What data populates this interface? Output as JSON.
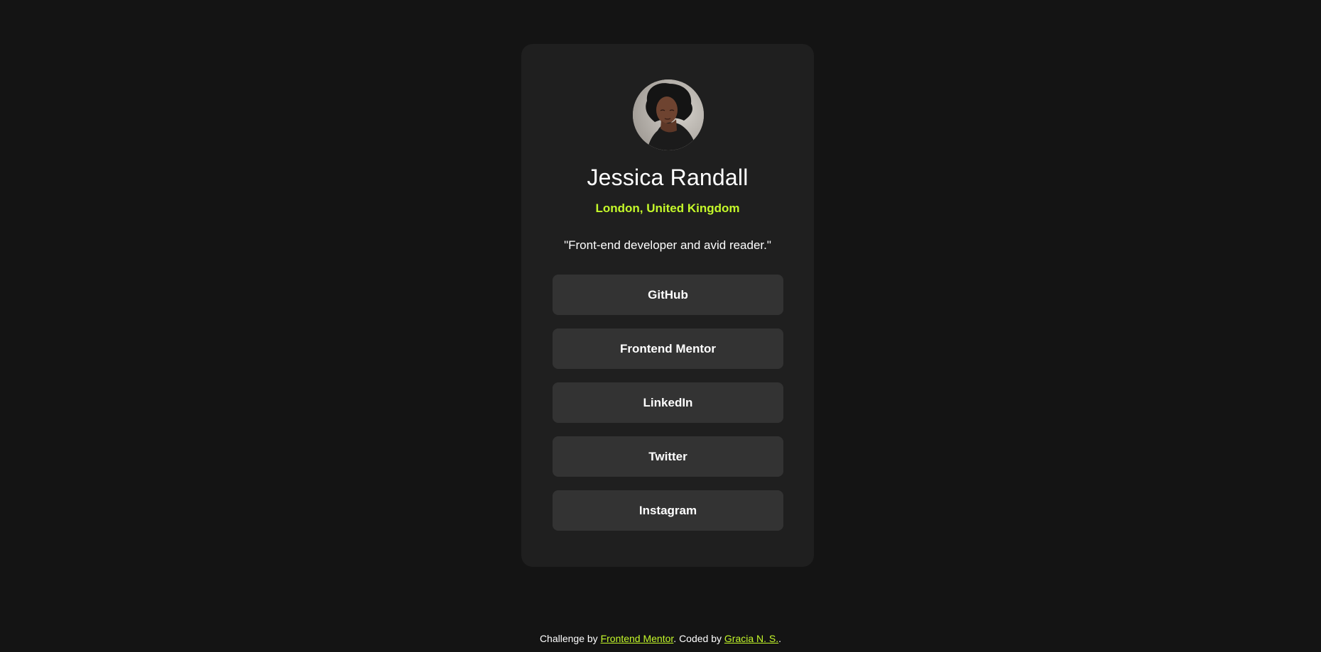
{
  "profile": {
    "name": "Jessica Randall",
    "location": "London, United Kingdom",
    "bio": "\"Front-end developer and avid reader.\""
  },
  "links": [
    {
      "label": "GitHub"
    },
    {
      "label": "Frontend Mentor"
    },
    {
      "label": "LinkedIn"
    },
    {
      "label": "Twitter"
    },
    {
      "label": "Instagram"
    }
  ],
  "footer": {
    "prefix": "Challenge by ",
    "challenge_link": "Frontend Mentor",
    "middle": ". Coded by ",
    "author_link": "Gracia N. S.",
    "suffix": "."
  },
  "colors": {
    "background": "#141414",
    "card": "#1f1f1f",
    "button": "#333333",
    "accent": "#c4f82a",
    "text": "#ffffff"
  },
  "icons": {
    "avatar": "profile-photo"
  }
}
